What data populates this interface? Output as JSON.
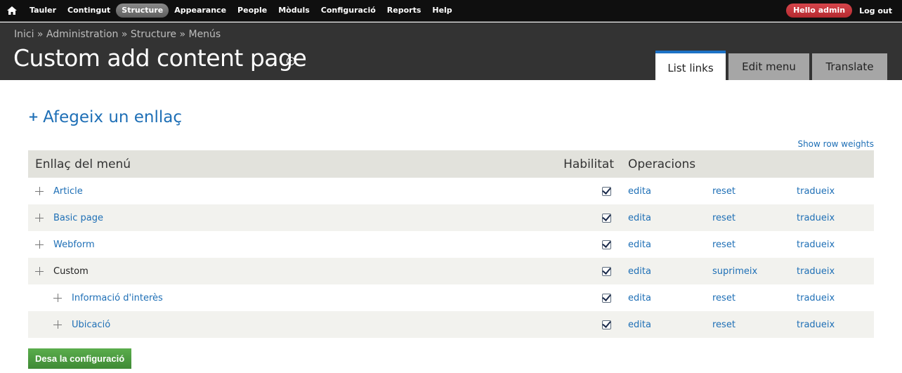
{
  "toolbar": {
    "items": [
      {
        "label": "Tauler",
        "active": false
      },
      {
        "label": "Contingut",
        "active": false
      },
      {
        "label": "Structure",
        "active": true
      },
      {
        "label": "Appearance",
        "active": false
      },
      {
        "label": "People",
        "active": false
      },
      {
        "label": "Mòduls",
        "active": false
      },
      {
        "label": "Configuració",
        "active": false
      },
      {
        "label": "Reports",
        "active": false
      },
      {
        "label": "Help",
        "active": false
      }
    ],
    "hello_prefix": "Hello ",
    "username": "admin",
    "logout_label": "Log out"
  },
  "header": {
    "breadcrumb": [
      "Inici",
      "Administration",
      "Structure",
      "Menús"
    ],
    "breadcrumb_separator": " » ",
    "title": "Custom add content page",
    "tabs": [
      {
        "label": "List links",
        "active": true
      },
      {
        "label": "Edit menu",
        "active": false
      },
      {
        "label": "Translate",
        "active": false
      }
    ]
  },
  "content": {
    "add_link_label": "Afegeix un enllaç",
    "show_weights_label": "Show row weights",
    "table": {
      "headers": {
        "link": "Enllaç del menú",
        "enabled": "Habilitat",
        "operations": "Operacions"
      },
      "rows": [
        {
          "name": "Article",
          "depth": 0,
          "is_link": true,
          "enabled": true,
          "ops": [
            "edita",
            "reset",
            "tradueix"
          ]
        },
        {
          "name": "Basic page",
          "depth": 0,
          "is_link": true,
          "enabled": true,
          "ops": [
            "edita",
            "reset",
            "tradueix"
          ]
        },
        {
          "name": "Webform",
          "depth": 0,
          "is_link": true,
          "enabled": true,
          "ops": [
            "edita",
            "reset",
            "tradueix"
          ]
        },
        {
          "name": "Custom",
          "depth": 0,
          "is_link": false,
          "enabled": true,
          "ops": [
            "edita",
            "suprimeix",
            "tradueix"
          ]
        },
        {
          "name": "Informació d'interès",
          "depth": 1,
          "is_link": true,
          "enabled": true,
          "ops": [
            "edita",
            "reset",
            "tradueix"
          ]
        },
        {
          "name": "Ubicació",
          "depth": 1,
          "is_link": true,
          "enabled": true,
          "ops": [
            "edita",
            "reset",
            "tradueix"
          ]
        }
      ]
    },
    "save_label": "Desa la configuració"
  },
  "colors": {
    "toolbar_bg": "#0f0f0f",
    "header_bg": "#333333",
    "link": "#1e6fb6",
    "active_tab_border": "#1d72c6",
    "hello_badge": "#c5343a",
    "save_button": "#4a9a3e"
  }
}
